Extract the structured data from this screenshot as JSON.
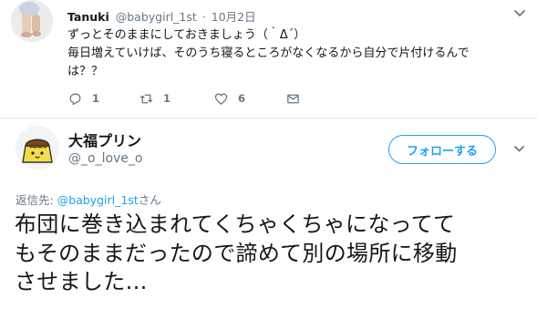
{
  "parent_tweet": {
    "display_name": "Tanuki",
    "handle": "@babygirl_1st",
    "separator": "·",
    "timestamp": "10月2日",
    "text_lines": [
      "ずっとそのままにしておきましょう（｀Δ´）",
      "毎日増えていけば、そのうち寝るところがなくなるから自分で片付けるんで",
      "は？？"
    ],
    "actions": {
      "reply_count": "1",
      "retweet_count": "1",
      "like_count": "6"
    },
    "icons": [
      "reply-icon",
      "retweet-icon",
      "like-icon",
      "message-icon",
      "chevron-down-icon"
    ]
  },
  "reply_tweet": {
    "display_name": "大福プリン",
    "handle": "@_o_love_o",
    "follow_label": "フォローする",
    "reply_to_label": "返信先: ",
    "reply_to_mention": "@babygirl_1st",
    "reply_to_suffix": "さん",
    "text_lines": [
      "布団に巻き込まれてくちゃくちゃになってて",
      "もそのままだったので諦めて別の場所に移動",
      "させました…"
    ]
  },
  "colors": {
    "accent": "#1da1f2",
    "secondary_text": "#657786",
    "primary_text": "#14171a",
    "divider": "#e6ecf0"
  }
}
